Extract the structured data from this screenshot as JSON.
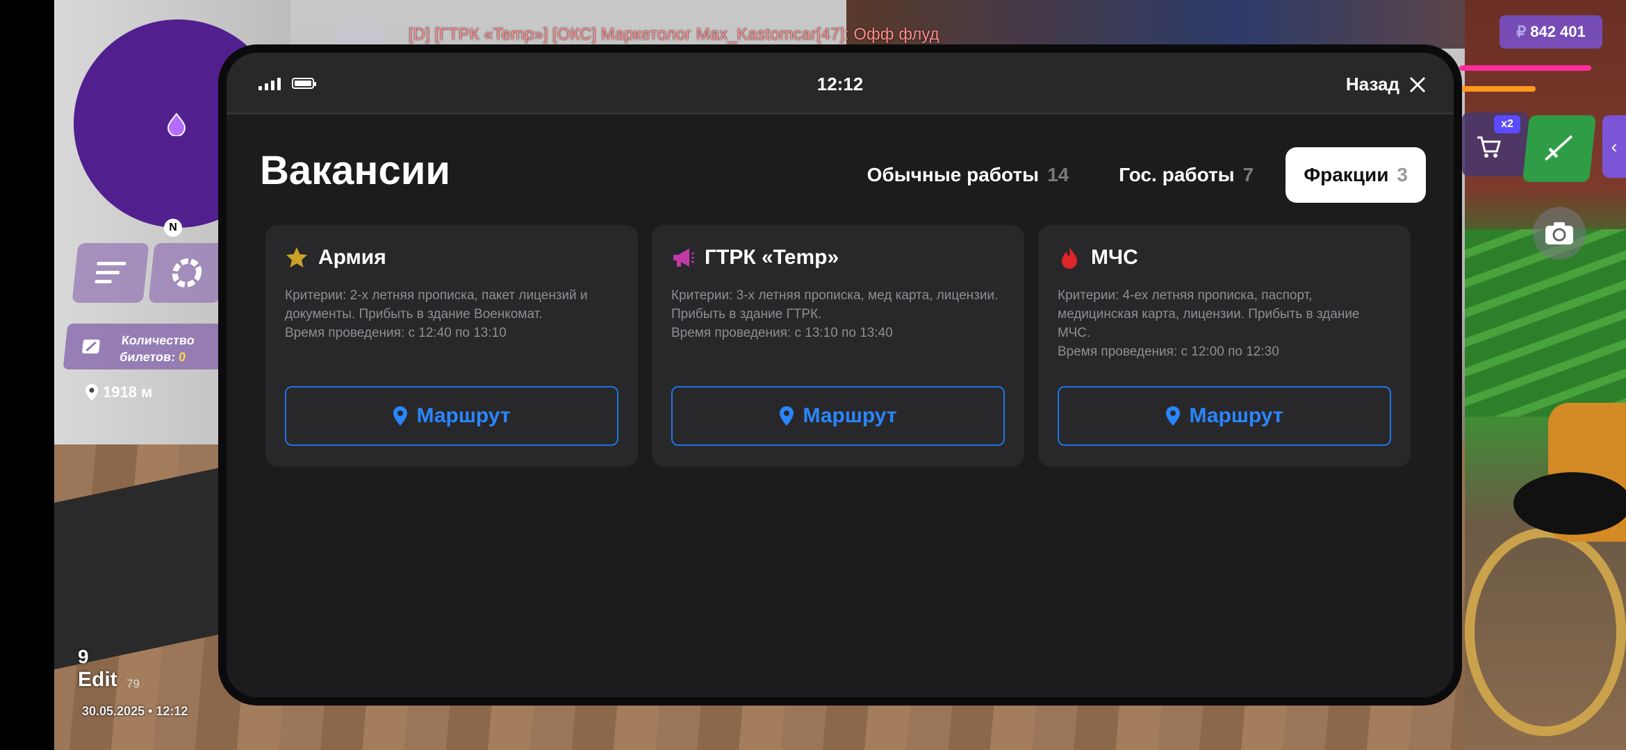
{
  "hud": {
    "chat_line": "[D] [ГТРК «Temp»] [ОКС] Маркетолог Max_Kastomcar[47]: Офф флуд",
    "money_currency": "₽",
    "money": "842 401",
    "multiplier": "x2",
    "compass": "N",
    "tickets_label_1": "Количество",
    "tickets_label_2": "билетов:",
    "tickets_value": "0",
    "distance": "1918 м",
    "bottom_number": "9",
    "bottom_edit": "Edit",
    "bottom_id": "79",
    "date": "30.05.2025 • 12:12"
  },
  "phone": {
    "time": "12:12",
    "back_label": "Назад",
    "title": "Вакансии",
    "tabs": [
      {
        "label": "Обычные работы",
        "count": "14",
        "active": false
      },
      {
        "label": "Гос. работы",
        "count": "7",
        "active": false
      },
      {
        "label": "Фракции",
        "count": "3",
        "active": true
      }
    ],
    "cards": [
      {
        "title": "Армия",
        "icon": "star-icon",
        "icon_color": "#c9a227",
        "criteria": "Критерии: 2-х летняя прописка, пакет лицензий и документы. Прибыть в здание Военкомат.",
        "time": "Время проведения: с 12:40 по 13:10",
        "button": "Маршрут"
      },
      {
        "title": "ГТРК «Temp»",
        "icon": "megaphone-icon",
        "icon_color": "#c23aa8",
        "criteria": "Критерии: 3-х летняя прописка, мед карта, лицензии. Прибыть в здание ГТРК.",
        "time": "Время проведения: с 13:10 по 13:40",
        "button": "Маршрут"
      },
      {
        "title": "МЧС",
        "icon": "flame-icon",
        "icon_color": "#e0242c",
        "criteria": "Критерии: 4-ех летняя прописка, паспорт, медицинская карта, лицензии. Прибыть в здание МЧС.",
        "time": "Время проведения: с 12:00 по 12:30",
        "button": "Маршрут"
      }
    ]
  },
  "colors": {
    "accent_blue": "#2a86ff",
    "phone_bg": "#1c1c1e",
    "card_bg": "#28282b",
    "money_bg": "#7850c8"
  }
}
